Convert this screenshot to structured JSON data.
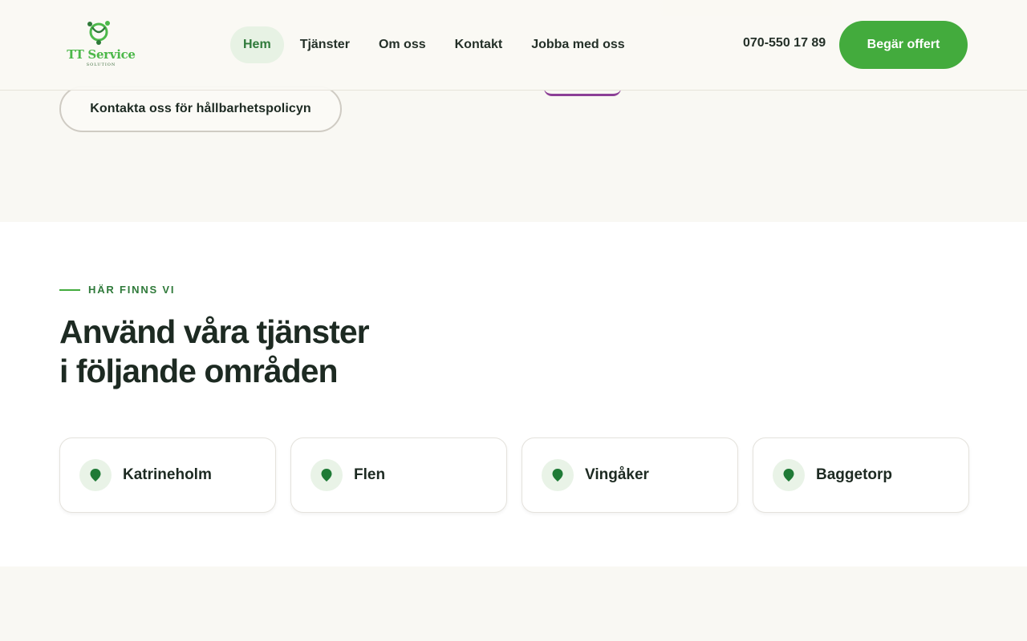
{
  "header": {
    "logo_text": "TT Service",
    "logo_sub": "SOLUTION",
    "nav": [
      {
        "label": "Hem",
        "active": true
      },
      {
        "label": "Tjänster",
        "active": false
      },
      {
        "label": "Om oss",
        "active": false
      },
      {
        "label": "Kontakt",
        "active": false
      },
      {
        "label": "Jobba med oss",
        "active": false
      }
    ],
    "phone": "070-550 17 89",
    "cta_label": "Begär offert"
  },
  "hero": {
    "policy_button_label": "Kontakta oss för hållbarhetspolicyn"
  },
  "locations": {
    "eyebrow": "HÄR FINNS VI",
    "title_line1": "Använd våra tjänster",
    "title_line2": "i följande områden",
    "cards": [
      {
        "label": "Katrineholm",
        "icon": "map-pin-icon"
      },
      {
        "label": "Flen",
        "icon": "map-pin-icon"
      },
      {
        "label": "Vingåker",
        "icon": "map-pin-icon"
      },
      {
        "label": "Baggetorp",
        "icon": "map-pin-icon"
      }
    ]
  },
  "colors": {
    "brand_green": "#43ab3d",
    "dark_green": "#2f7a3a",
    "text_dark": "#1d2a22",
    "background_cream": "#f9f8f3"
  }
}
